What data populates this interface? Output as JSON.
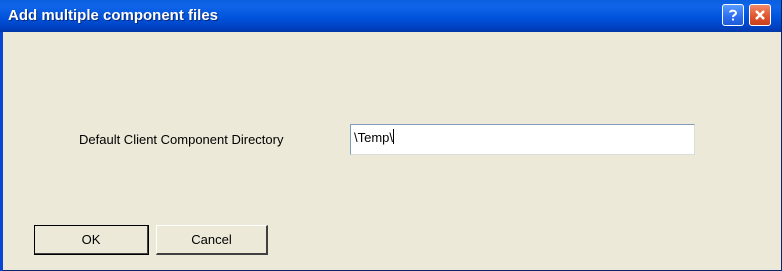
{
  "window": {
    "title": "Add multiple component files",
    "help_icon": "question-mark-icon",
    "close_icon": "close-x-icon",
    "colors": {
      "titlebar": "#0053dc",
      "dialog_bg": "#ece9d8",
      "close_red": "#e2562e"
    }
  },
  "form": {
    "directory_label": "Default Client Component Directory",
    "directory_value": "\\Temp\\"
  },
  "buttons": {
    "ok_label": "OK",
    "cancel_label": "Cancel"
  }
}
